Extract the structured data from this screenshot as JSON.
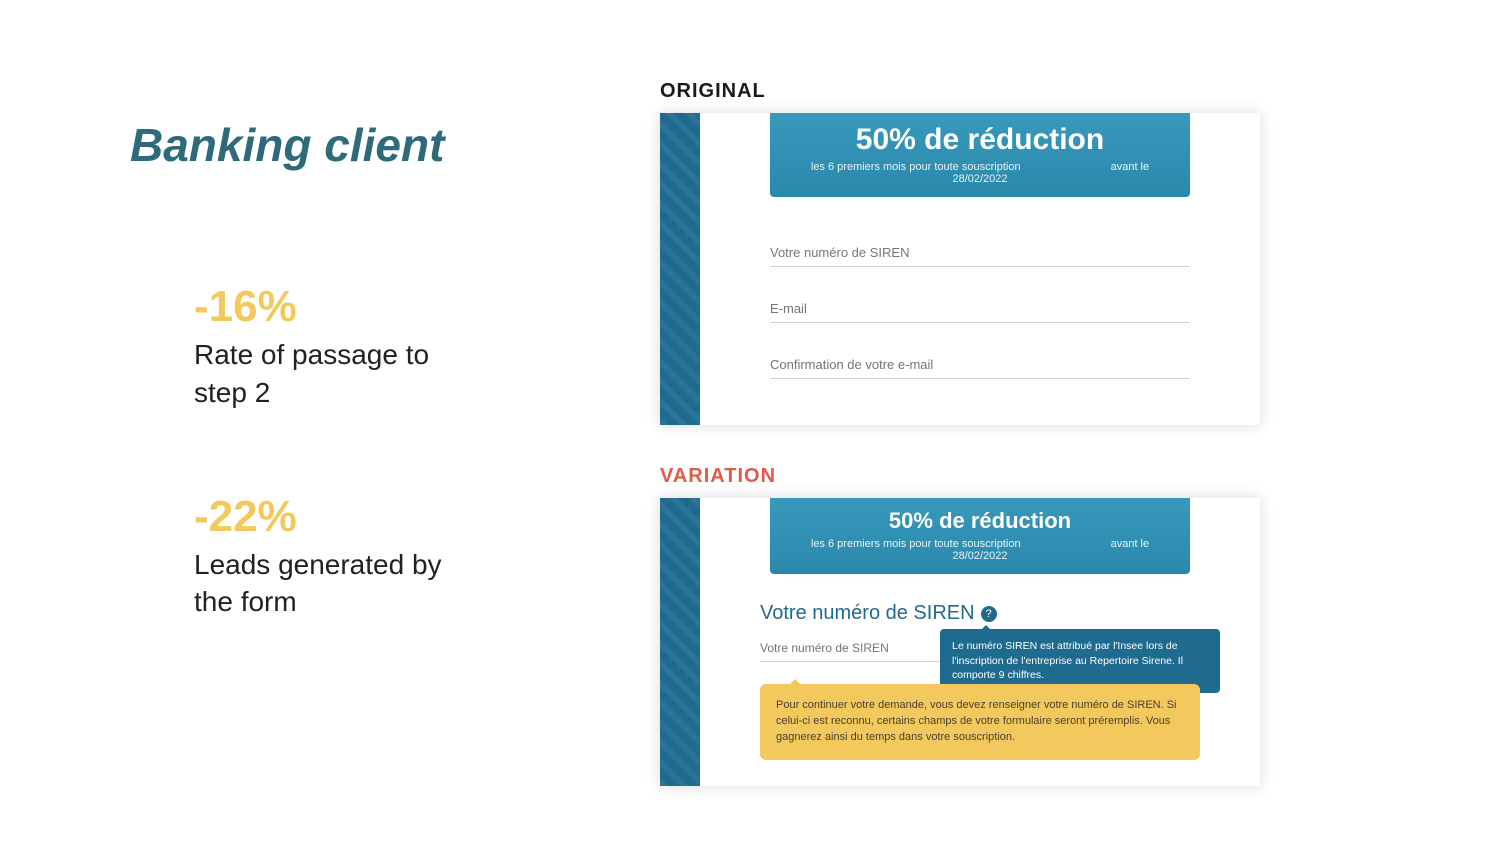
{
  "title": "Banking client",
  "stats": [
    {
      "value": "-16%",
      "desc": "Rate of passage to step 2"
    },
    {
      "value": "-22%",
      "desc": "Leads generated by the form"
    }
  ],
  "labels": {
    "original": "ORIGINAL",
    "variation": "VARIATION"
  },
  "promo": {
    "title": "50% de réduction",
    "sub_prefix": "les 6 premiers mois pour toute souscription",
    "sub_suffix": "avant le",
    "date": "28/02/2022"
  },
  "original_form": {
    "siren": "Votre numéro de SIREN",
    "email": "E-mail",
    "email_confirm": "Confirmation de votre e-mail"
  },
  "variation": {
    "heading": "Votre numéro de SIREN",
    "info_icon": "?",
    "field_placeholder": "Votre numéro de SIREN",
    "tooltip_blue": "Le numéro SIREN est attribué par l'Insee lors de l'inscription de l'entreprise au Repertoire Sirene. Il comporte 9 chiffres.",
    "tooltip_yellow": "Pour continuer votre demande, vous devez renseigner votre numéro de SIREN. Si celui-ci est reconnu, certains champs de votre formulaire seront préremplis. Vous gagnerez ainsi du temps dans votre souscription."
  }
}
